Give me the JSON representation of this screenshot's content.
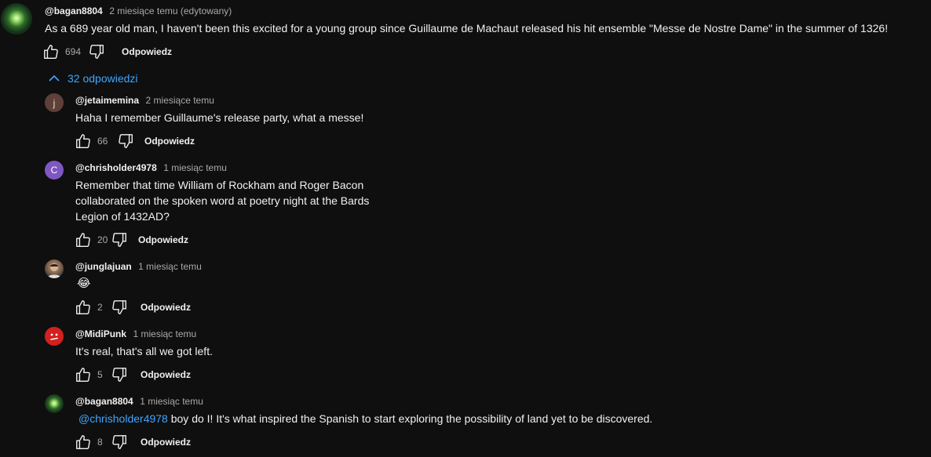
{
  "main_comment": {
    "author": "@bagan8804",
    "time": "2 miesiące temu (edytowany)",
    "text": "As a 689 year old man, I haven't been this excited for a young group since Guillaume de Machaut released his hit ensemble \"Messe de Nostre Dame\" in the summer of 1326!",
    "likes": "694",
    "reply_label": "Odpowiedz",
    "avatar_icon": "galaxy-avatar"
  },
  "replies_toggle": {
    "label": "32 odpowiedzi",
    "icon": "chevron-up-icon"
  },
  "replies": [
    {
      "author": "@jetaimemina",
      "time": "2 miesiące temu",
      "avatar_letter": "j",
      "avatar_color": "#5d4037",
      "lines": [
        "Haha I remember Guillaume's release party, what a messe!"
      ],
      "likes": "66",
      "reply_label": "Odpowiedz"
    },
    {
      "author": "@chrisholder4978",
      "time": "1 miesiąc temu",
      "avatar_letter": "C",
      "avatar_color": "#7e57c2",
      "lines": [
        "Remember that time William of Rockham and Roger Bacon",
        "collaborated on the spoken word at poetry night at the Bards",
        "Legion of 1432AD?"
      ],
      "likes": "20",
      "reply_label": "Odpowiedz"
    },
    {
      "author": "@junglajuan",
      "time": "1 miesiąc temu",
      "emoji": "😂",
      "likes": "2",
      "reply_label": "Odpowiedz"
    },
    {
      "author": "@MidiPunk",
      "time": "1 miesiąc temu",
      "lines": [
        "It's real, that's all we got left."
      ],
      "likes": "5",
      "reply_label": "Odpowiedz"
    },
    {
      "author": "@bagan8804",
      "time": "1 miesiąc temu",
      "mention": "@chrisholder4978",
      "text_after_mention": " boy do I! It's what inspired the Spanish to start exploring the possibility of land yet to be discovered.",
      "likes": "8",
      "reply_label": "Odpowiedz"
    }
  ],
  "colors": {
    "background": "#0f0f0f",
    "text": "#f1f1f1",
    "secondary_text": "#aaaaaa",
    "link": "#3ea6ff"
  }
}
